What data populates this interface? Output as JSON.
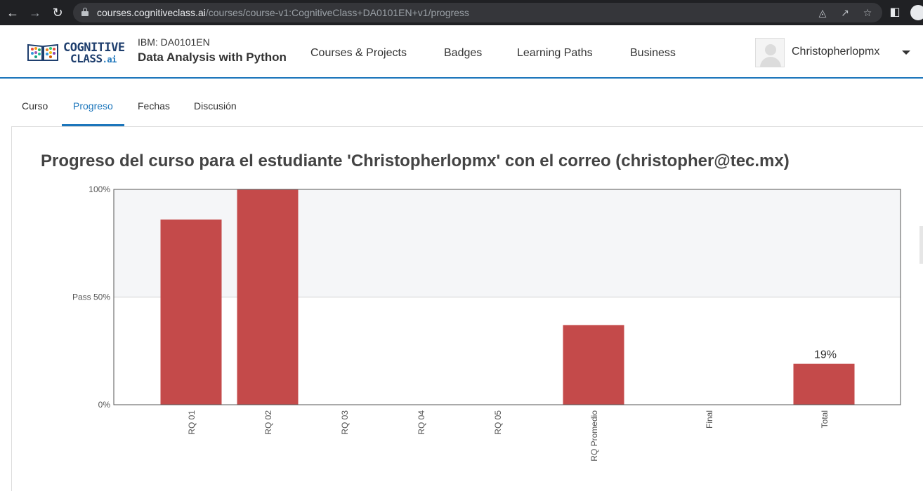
{
  "browser": {
    "url_host": "courses.cognitiveclass.ai",
    "url_path": "/courses/course-v1:CognitiveClass+DA0101EN+v1/progress"
  },
  "header": {
    "logo_line1": "COGNITIVE",
    "logo_line2": "CLASS",
    "logo_suffix": ".ai",
    "course_code": "IBM: DA0101EN",
    "course_name": "Data Analysis with Python",
    "nav": [
      "Courses & Projects",
      "Badges",
      "Learning Paths",
      "Business"
    ],
    "username": "Christopherlopmx"
  },
  "tabs": [
    {
      "label": "Curso",
      "active": false
    },
    {
      "label": "Progreso",
      "active": true
    },
    {
      "label": "Fechas",
      "active": false
    },
    {
      "label": "Discusión",
      "active": false
    }
  ],
  "progress": {
    "title": "Progreso del curso para el estudiante 'Christopherlopmx' con el correo (christopher@tec.mx)"
  },
  "colors": {
    "accent": "#1b75bb",
    "bar": "#c44a4a",
    "pass_zone": "#f5f6f8"
  },
  "chart_data": {
    "type": "bar",
    "categories": [
      "RQ 01",
      "RQ 02",
      "RQ 03",
      "RQ 04",
      "RQ 05",
      "RQ Promedio",
      "Final",
      "Total"
    ],
    "values": [
      86,
      100,
      0,
      0,
      0,
      37,
      0,
      19
    ],
    "ylim": [
      0,
      100
    ],
    "yticks": [
      {
        "value": 100,
        "label": "100%"
      },
      {
        "value": 50,
        "label": "Pass 50%"
      },
      {
        "value": 0,
        "label": "0%"
      }
    ],
    "annotations": [
      {
        "category": "Total",
        "label": "19%"
      }
    ],
    "pass_threshold": 50
  }
}
